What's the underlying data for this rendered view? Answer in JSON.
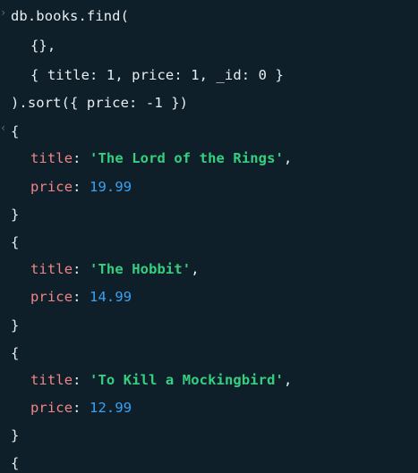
{
  "input": {
    "line1": "db.books.find(",
    "line2": "{},",
    "line3": "{ title: 1, price: 1, _id: 0 }",
    "line4": ").sort({ price: -1 })"
  },
  "output": {
    "docs": [
      {
        "title": "'The Lord of the Rings'",
        "price": "19.99"
      },
      {
        "title": "'The Hobbit'",
        "price": "14.99"
      },
      {
        "title": "'To Kill a Mockingbird'",
        "price": "12.99"
      }
    ],
    "key_title": "title",
    "key_price": "price",
    "open_brace": "{",
    "close_brace": "}",
    "colon": ": ",
    "comma": ","
  },
  "markers": {
    "prompt": "›",
    "result": "‹"
  },
  "colors": {
    "background": "#0f1f29",
    "key": "#f08585",
    "string": "#35d07f",
    "number": "#3aa2f2"
  }
}
